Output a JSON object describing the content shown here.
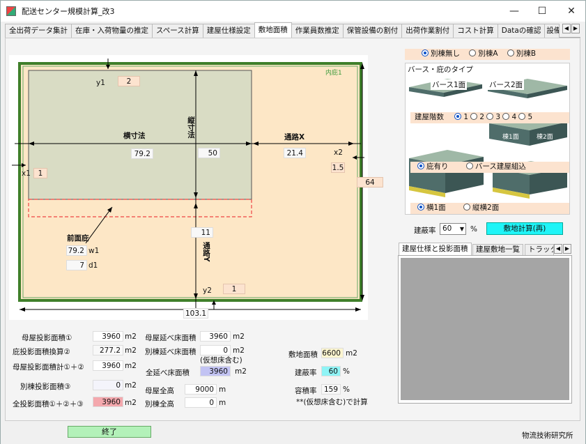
{
  "window": {
    "title": "配送センター規模計算_改3"
  },
  "tabs": [
    "全出荷データ集計",
    "在庫・入荷物量の推定",
    "スペース計算",
    "建屋仕様設定",
    "敷地面積",
    "作業員数推定",
    "保管設備の割付",
    "出荷作業割付",
    "コスト計算",
    "Dataの確認",
    "設備台"
  ],
  "diagram": {
    "inner_label": "内庇1",
    "y1_label": "y1",
    "y1": "2",
    "x1_label": "x1",
    "x1": "1",
    "x2_label": "x2",
    "x2": "1.5",
    "y2_label": "y2",
    "y2": "1",
    "yoko_label": "横寸法",
    "yoko": "79.2",
    "tate_label": "縦寸法",
    "tate": "50",
    "roX_label": "通路X",
    "roX": "21.4",
    "roY_label": "通路Y",
    "roY": "11",
    "front_label": "前面庇",
    "w1": "79.2",
    "w1_label": "w1",
    "d1": "7",
    "d1_label": "d1",
    "height_total": "64",
    "width_total": "103.1"
  },
  "right": {
    "annex_options": [
      "別棟無し",
      "別棟A",
      "別棟B"
    ],
    "base_type_label": "バース・庇のタイプ",
    "berth1": "バース1面",
    "berth2": "バース2面",
    "floors_label": "建屋階数",
    "floors": [
      "1",
      "2",
      "3",
      "4",
      "5"
    ],
    "eaves_options": [
      "庇有り",
      "バース建屋組込"
    ],
    "layout_options": [
      "横1面",
      "縦横2面"
    ],
    "block_a": "棟1面",
    "block_b": "棟2面",
    "coverage_label": "建蔽率",
    "coverage_select": "60",
    "coverage_unit": "%",
    "calc_button": "敷地計算(再)",
    "subtabs": [
      "建屋仕様と投影面積",
      "建屋敷地一覧",
      "トラック庫"
    ]
  },
  "bottom": {
    "main_proj_label": "母屋投影面積①",
    "main_proj": "3960",
    "eaves_proj_label": "庇投影面積換算②",
    "eaves_proj": "277.2",
    "main_total_label": "母屋投影面積計①＋②",
    "main_total": "3960",
    "annex_proj_label": "別棟投影面積③",
    "annex_proj": "0",
    "all_proj_label": "全投影面積①＋②＋③",
    "all_proj": "3960",
    "main_floor_label": "母屋延べ床面積",
    "main_floor": "3960",
    "annex_floor_label": "別棟延べ床面積",
    "annex_floor": "0",
    "virtual_note": "(仮想床含む)",
    "all_floor_label": "全延べ床面積",
    "all_floor": "3960",
    "main_height_label": "母屋全高",
    "main_height": "9000",
    "annex_height_label": "別棟全高",
    "annex_height": "0",
    "site_label": "敷地面積",
    "site": "6600",
    "cov_label": "建蔽率",
    "cov": "60",
    "far_label": "容積率",
    "far": "159",
    "calc_note": "**(仮想床含む)で計算",
    "unit_m2": "m2",
    "unit_m": "m",
    "unit_pct": "%"
  },
  "footer": {
    "end_button": "終了",
    "org": "物流技術研究所"
  }
}
